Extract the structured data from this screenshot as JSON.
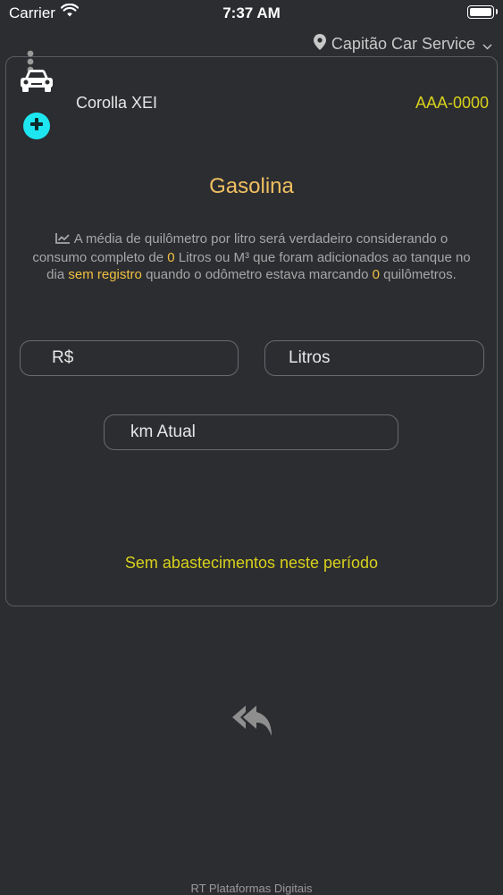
{
  "status_bar": {
    "carrier": "Carrier",
    "time": "7:37 AM"
  },
  "location": {
    "name": "Capitão Car Service"
  },
  "vehicle": {
    "name": "Corolla XEI",
    "plate": "AAA-0000"
  },
  "fuel": {
    "title": "Gasolina"
  },
  "info": {
    "part1": "A média de quilômetro por litro será verdadeiro considerando o consumo completo de",
    "liters": "0",
    "part2": "Litros ou M³ que foram adicionados ao tanque no dia",
    "date": "sem registro",
    "part3": "quando o odômetro estava marcando",
    "odometer": "0",
    "part4": "quilômetros."
  },
  "fields": {
    "rs": "R$",
    "litros": "Litros",
    "km": "km Atual"
  },
  "empty_message": "Sem abastecimentos neste período",
  "footer": "RT Plataformas Digitais",
  "colors": {
    "accent_yellow": "#d8d11c",
    "title_orange": "#f0c060",
    "plus_cyan": "#1de6f0",
    "background": "#2c2d31"
  },
  "icons": [
    "wifi-icon",
    "battery-icon",
    "location-pin-icon",
    "chevron-down-icon",
    "car-icon",
    "more-dots-icon",
    "plus-icon",
    "trend-chart-icon",
    "reply-all-icon"
  ]
}
